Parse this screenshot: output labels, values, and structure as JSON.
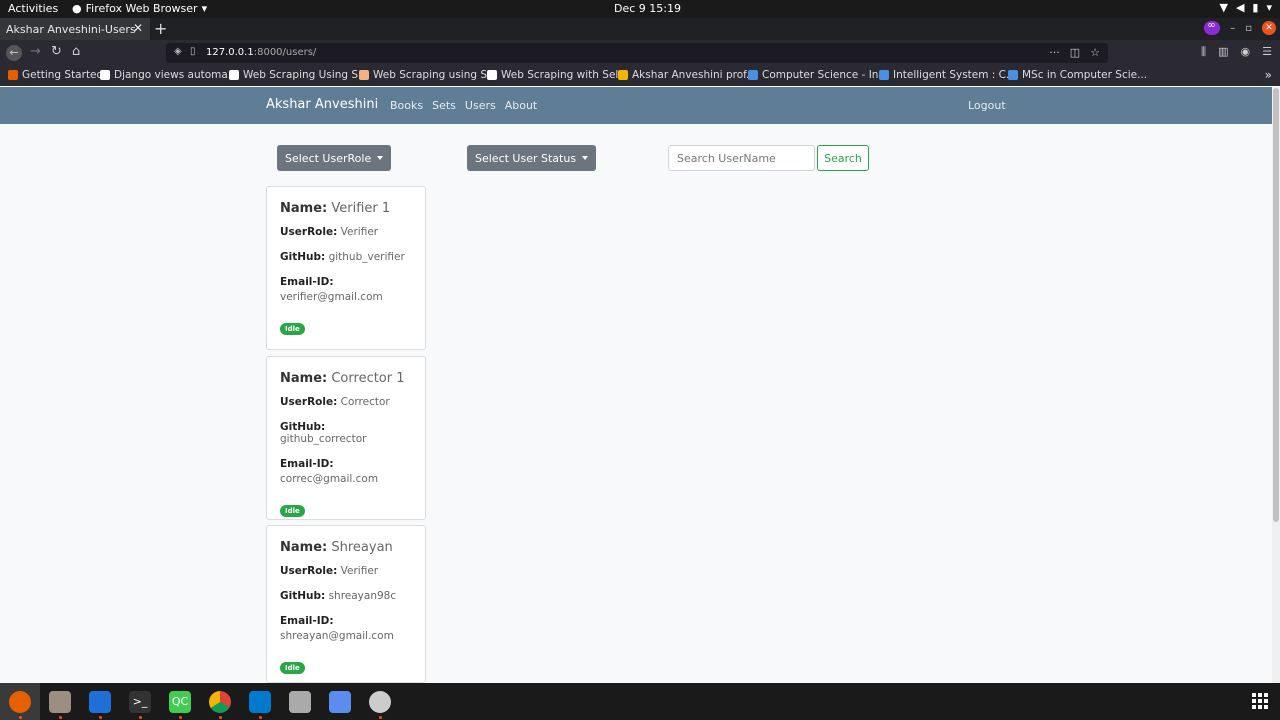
{
  "system": {
    "activities": "Activities",
    "app_name": "Firefox Web Browser",
    "clock": "Dec 9  15:19"
  },
  "browser": {
    "tab_title": "Akshar Anveshini-Users",
    "url_host": "127.0.0.1",
    "url_rest": ":8000/users/",
    "bookmarks": [
      {
        "label": "Getting Started",
        "color": "#e66000"
      },
      {
        "label": "Django views automa...",
        "color": "#ffffff"
      },
      {
        "label": "Web Scraping Using S...",
        "color": "#ffffff"
      },
      {
        "label": "Web Scraping using S...",
        "color": "#f4b183"
      },
      {
        "label": "Web Scraping with Sel...",
        "color": "#ffffff"
      },
      {
        "label": "Akshar Anveshini prof...",
        "color": "#f4b400"
      },
      {
        "label": "Computer Science - In...",
        "color": "#4a90e2"
      },
      {
        "label": "Intelligent System : C...",
        "color": "#4a90e2"
      },
      {
        "label": "MSc in Computer Scie...",
        "color": "#4a90e2"
      }
    ]
  },
  "site": {
    "brand": "Akshar Anveshini",
    "nav": [
      "Books",
      "Sets",
      "Users",
      "About"
    ],
    "logout": "Logout"
  },
  "filters": {
    "role_label": "Select UserRole",
    "status_label": "Select User Status",
    "search_placeholder": "Search UserName",
    "search_button": "Search"
  },
  "users": [
    {
      "name": "Verifier 1",
      "role": "Verifier",
      "github": "github_verifier",
      "email": "verifier@gmail.com",
      "status": "Idle"
    },
    {
      "name": "Corrector 1",
      "role": "Corrector",
      "github": "github_corrector",
      "email": "correc@gmail.com",
      "status": "Idle"
    },
    {
      "name": "Shreayan",
      "role": "Verifier",
      "github": "shreayan98c",
      "email": "shreayan@gmail.com",
      "status": "Idle"
    }
  ],
  "labels": {
    "name": "Name:",
    "role": "UserRole:",
    "github": "GitHub:",
    "email": "Email-ID:"
  },
  "colors": {
    "site_nav": "#5f7d95",
    "badge": "#28a745",
    "dropdown": "#6c757d"
  }
}
